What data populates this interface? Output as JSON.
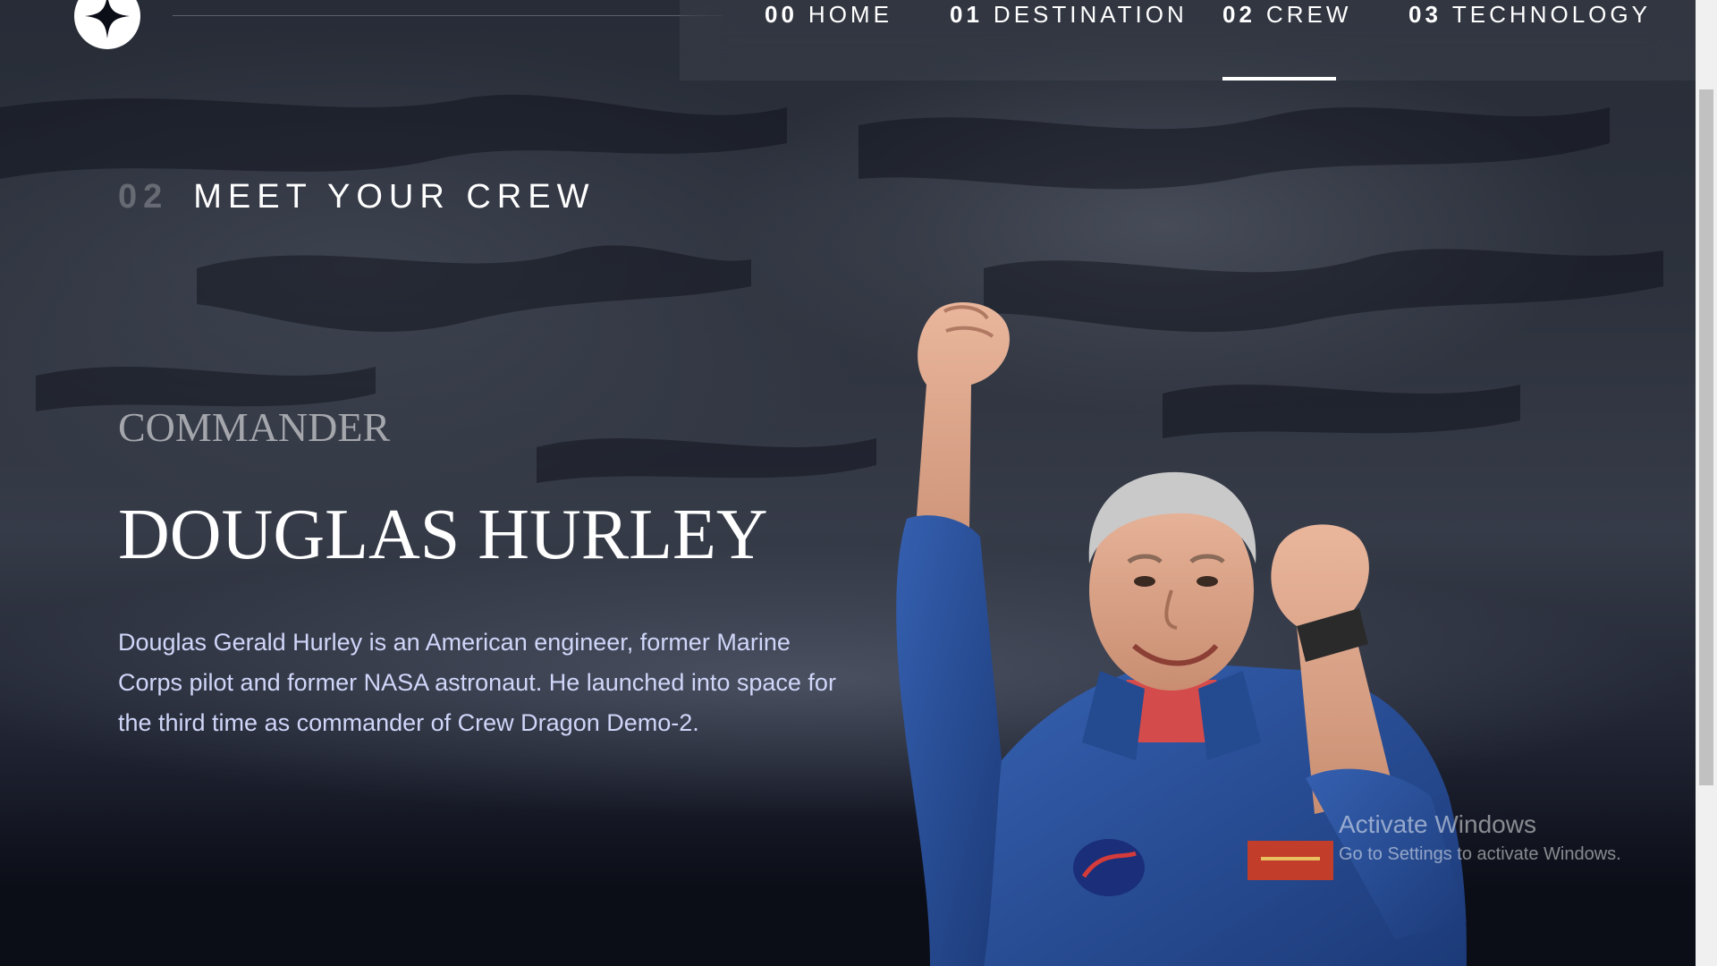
{
  "header": {
    "logo_icon": "four-point-star-icon",
    "nav": [
      {
        "num": "00",
        "label": "HOME"
      },
      {
        "num": "01",
        "label": "DESTINATION"
      },
      {
        "num": "02",
        "label": "CREW",
        "active": true
      },
      {
        "num": "03",
        "label": "TECHNOLOGY"
      }
    ]
  },
  "page": {
    "heading_num": "02",
    "heading_label": "MEET YOUR CREW"
  },
  "crew_member": {
    "role": "COMMANDER",
    "name": "DOUGLAS HURLEY",
    "bio": "Douglas Gerald Hurley is an American engineer, former Marine Corps pilot and former NASA astronaut. He launched into space for the third time as commander of Crew Dragon Demo-2.",
    "image_alt": "astronaut-portrait"
  },
  "overlay": {
    "activate_title": "Activate Windows",
    "activate_sub": "Go to Settings to activate Windows."
  },
  "colors": {
    "background": "#0b0d17",
    "bio_text": "#d0d6f9",
    "suit_blue": "#2b4f9a"
  }
}
